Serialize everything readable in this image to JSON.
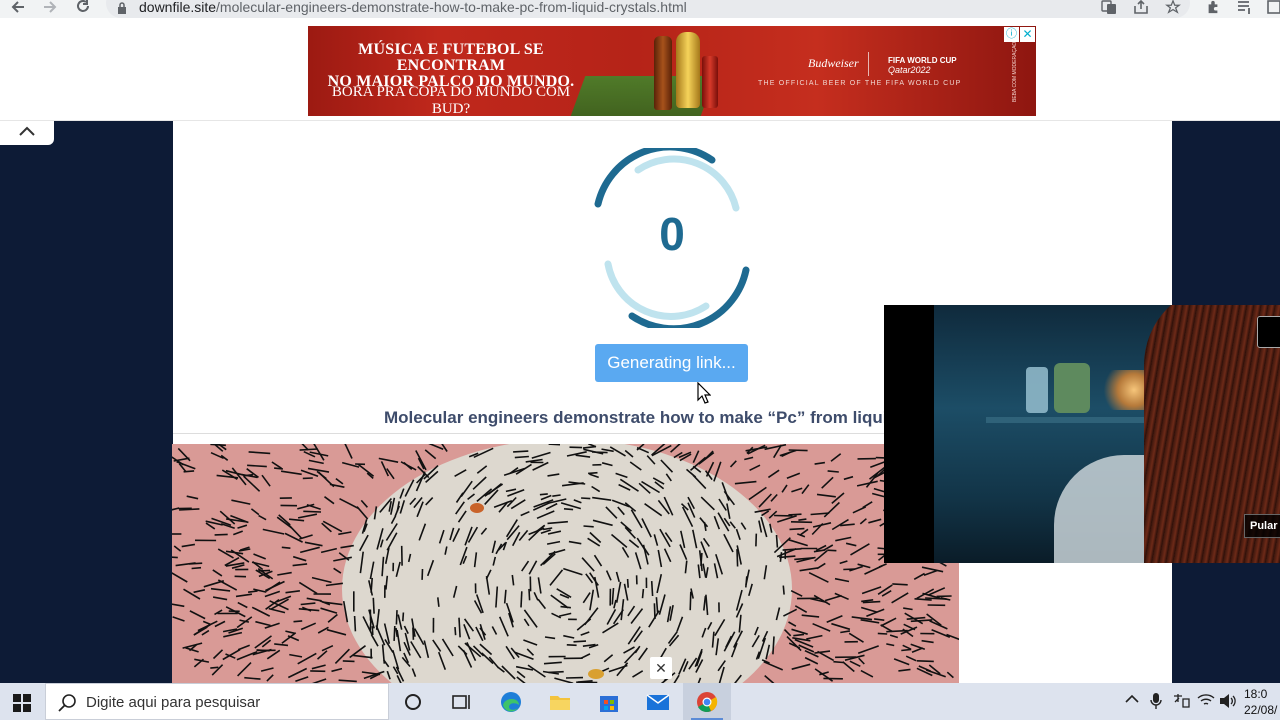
{
  "browser": {
    "url_domain": "downfile.site",
    "url_path": "/molecular-engineers-demonstrate-how-to-make-pc-from-liquid-crystals.html",
    "icons": [
      "back-icon",
      "forward-icon",
      "reload-icon",
      "lock-icon",
      "translate-icon",
      "share-icon",
      "bookmark-star-icon",
      "extensions-icon",
      "reading-list-icon",
      "side-panel-icon"
    ]
  },
  "ad": {
    "line1": "MÚSICA E FUTEBOL SE ENCONTRAM",
    "line1b": "NO MAIOR PALCO DO MUNDO.",
    "line2": "BORA PRA COPA DO MUNDO COM BUD?",
    "brand": "Budweiser",
    "event_top": "FIFA WORLD CUP",
    "event_bottom": "Qatar2022",
    "tagline": "THE OFFICIAL BEER OF THE FIFA WORLD CUP",
    "side_text": "BEBA COM MODERAÇÃO",
    "info_icon": "ⓘ",
    "close_icon": "✕"
  },
  "page": {
    "countdown": "0",
    "button_label": "Generating link...",
    "article_title": "Molecular engineers demonstrate how to make “Pc” from liquid crystals"
  },
  "video": {
    "skip_label": "Pular",
    "float_close": "✕"
  },
  "taskbar": {
    "search_placeholder": "Digite aqui para pesquisar",
    "apps": [
      "cortana-icon",
      "task-view-icon",
      "edge-icon",
      "file-explorer-icon",
      "store-icon",
      "mail-icon",
      "chrome-icon"
    ],
    "active_app": "chrome-icon",
    "tray_icons": [
      "chevron-up-icon",
      "microphone-icon",
      "ime-icon",
      "wifi-icon",
      "volume-icon"
    ],
    "time": "18:0",
    "date": "22/08/"
  },
  "colors": {
    "page_bg": "#0d1b36",
    "button": "#5aa9f1",
    "spinner_dark": "#1e6a91",
    "spinner_light": "#bfe3ee",
    "title_text": "#3e4c6b",
    "ad_red": "#b52318"
  }
}
